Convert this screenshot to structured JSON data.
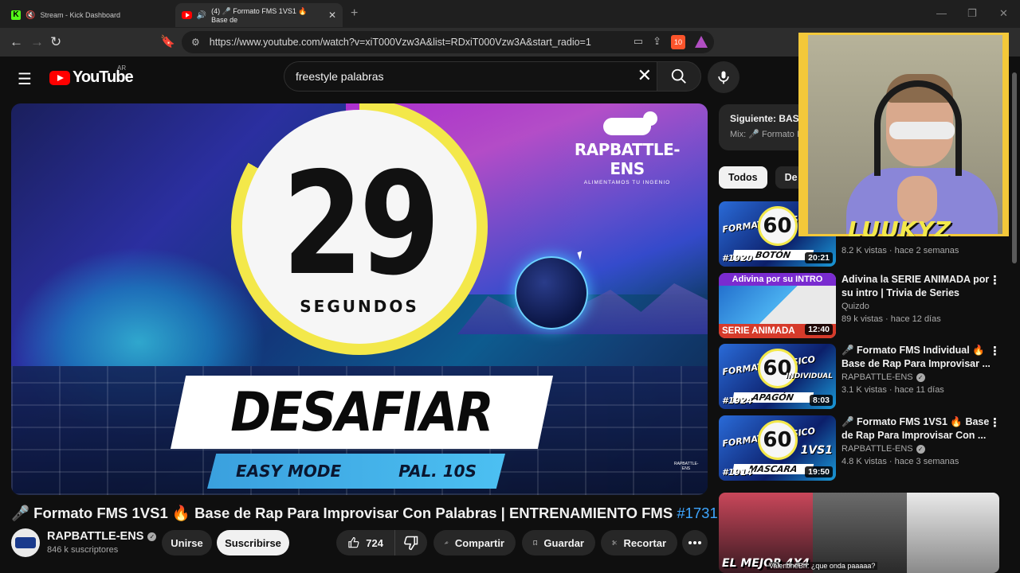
{
  "browser": {
    "tabs": [
      {
        "title": "Stream - Kick Dashboard",
        "active": false
      },
      {
        "title": "(4) 🎤 Formato FMS 1VS1 🔥 Base de",
        "active": true
      }
    ],
    "url": "https://www.youtube.com/watch?v=xiT000Vzw3A&list=RDxiT000Vzw3A&start_radio=1",
    "brave_badge": "10"
  },
  "youtube": {
    "logo_text": "YouTube",
    "country": "AR",
    "search_query": "freestyle palabras"
  },
  "player": {
    "timer_value": "29",
    "timer_unit": "SEGUNDOS",
    "brand_name": "RAPBATTLE-ENS",
    "brand_tagline": "ALIMENTAMOS TU INGENIO",
    "word": "DESAFIAR",
    "mode": "EASY MODE",
    "interval": "PAL. 10S",
    "watermark": "RAPBATTLE-ENS"
  },
  "video": {
    "title": "🎤 Formato FMS 1VS1 🔥 Base de Rap Para Improvisar Con Palabras | ENTRENAMIENTO FMS",
    "hashtag": "#1731",
    "channel": "RAPBATTLE-ENS",
    "subscribers": "846 k suscriptores",
    "join_label": "Unirse",
    "subscribe_label": "Suscribirse",
    "likes": "724",
    "share_label": "Compartir",
    "save_label": "Guardar",
    "clip_label": "Recortar"
  },
  "sidebar": {
    "up_next_label": "Siguiente: BASE",
    "up_next_sub": "Mix: 🎤 Formato F",
    "chips": [
      "Todos",
      "De tu"
    ],
    "recommendations": [
      {
        "title": "",
        "channel": "",
        "meta": "8.2 K vistas · hace 2 semanas",
        "duration": "20:21",
        "thumb_top": "FORMATO CLÁSICO",
        "thumb_num": "60",
        "thumb_word": "BOTÓN",
        "thumb_id": "#1920"
      },
      {
        "title": "Adivina la SERIE ANIMADA por su intro | Trivia de Series",
        "channel": "Quizdo",
        "meta": "89 k vistas · hace 12 días",
        "duration": "12:40",
        "thumb_top": "Adivina por su INTRO",
        "thumb_word": "SERIE ANIMADA"
      },
      {
        "title": "🎤 Formato FMS Individual 🔥 Base de Rap Para Improvisar ...",
        "channel": "RAPBATTLE-ENS",
        "meta": "3.1 K vistas · hace 11 días",
        "duration": "8:03",
        "thumb_top": "FORMATO CLÁSICO",
        "thumb_num": "60",
        "thumb_word": "APAGÓN",
        "thumb_right": "INDIVIDUAL",
        "thumb_id": "#1924"
      },
      {
        "title": "🎤 Formato FMS 1VS1 🔥 Base de Rap Para Improvisar Con ...",
        "channel": "RAPBATTLE-ENS",
        "meta": "4.8 K vistas · hace 3 semanas",
        "duration": "19:50",
        "thumb_top": "FORMATO CLÁSICO",
        "thumb_num": "60",
        "thumb_word": "MASCARA",
        "thumb_right": "1VS1",
        "thumb_id": "#1914"
      }
    ],
    "bottom_caption": "EL MEJOR 4X4",
    "bottom_chat": "ValentineBri: ¿que onda paaaaa?"
  },
  "webcam": {
    "streamer_name": "LUUKYZ"
  },
  "colors": {
    "bg": "#0f0f0f",
    "accent_red": "#ff0000",
    "link_blue": "#3ea6ff",
    "timer_yellow": "#f3e84a"
  }
}
